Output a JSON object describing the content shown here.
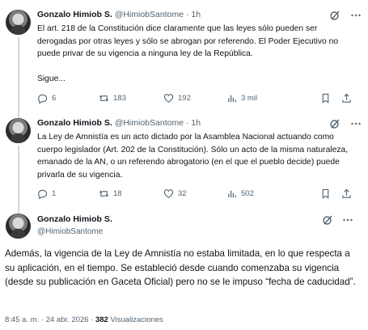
{
  "tweets": [
    {
      "author": "Gonzalo Himiob S.",
      "handle": "@HimiobSantome",
      "dot": "·",
      "time": "1h",
      "text": "El art. 218 de la Constitución dice claramente que las leyes sólo pueden ser derogadas por otras leyes y sólo se abrogan por referendo. El Poder Ejecutivo no puede privar de su vigencia a ninguna ley de la República.\n\nSigue...",
      "replies": "6",
      "reposts": "183",
      "likes": "192",
      "views": "3 mil"
    },
    {
      "author": "Gonzalo Himiob S.",
      "handle": "@HimiobSantome",
      "dot": "·",
      "time": "1h",
      "text": "La Ley de Amnistía es un acto dictado por la Asamblea Nacional actuando como cuerpo legislador (Art. 202 de la Constitución). Sólo un acto de la misma naturaleza, emanado de la AN, o un referendo abrogatorio (en el que el pueblo decide) puede privarla de su vigencia.",
      "replies": "1",
      "reposts": "18",
      "likes": "32",
      "views": "502"
    }
  ],
  "main": {
    "author": "Gonzalo Himiob S.",
    "handle": "@HimiobSantome",
    "text": "Además, la vigencia de la Ley de Amnistía no estaba limitada, en lo que respecta a su aplicación, en el tiempo. Se estableció desde cuando comenzaba su vigencia (desde su publicación en Gaceta Oficial) pero no se le impuso “fecha de caducidad”.",
    "time": "8:45 a. m.",
    "dot": "·",
    "date": "24 abr. 2026",
    "views_count": "382",
    "views_label": "Visualizaciones"
  },
  "icons": {
    "more": "more-horizontal-icon",
    "grok": "grok-slash-icon",
    "reply": "reply-icon",
    "repost": "repost-icon",
    "like": "heart-icon",
    "views": "views-bar-icon",
    "bookmark": "bookmark-icon",
    "share": "share-icon"
  },
  "colors": {
    "text": "#0f1419",
    "muted": "#536471",
    "divider": "#eff3f4"
  }
}
